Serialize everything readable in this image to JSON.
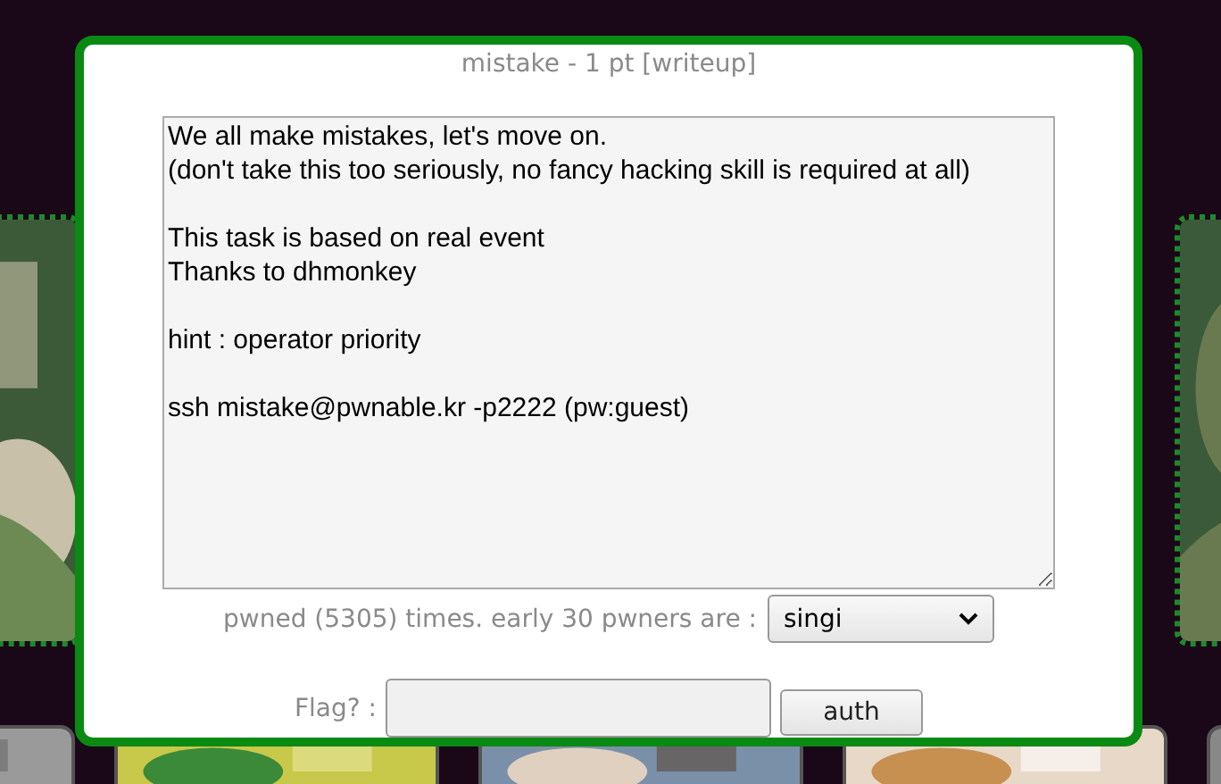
{
  "dialog": {
    "title": "mistake - 1 pt [writeup]",
    "description": "We all make mistakes, let's move on.\n(don't take this too seriously, no fancy hacking skill is required at all)\n\nThis task is based on real event\nThanks to dhmonkey\n\nhint : operator priority\n\nssh mistake@pwnable.kr -p2222 (pw:guest)",
    "pwned_text": "pwned (5305) times. early 30 pwners are :",
    "pwners_select": {
      "value": "singi"
    },
    "flag_label": "Flag? :",
    "auth_button": "auth"
  }
}
